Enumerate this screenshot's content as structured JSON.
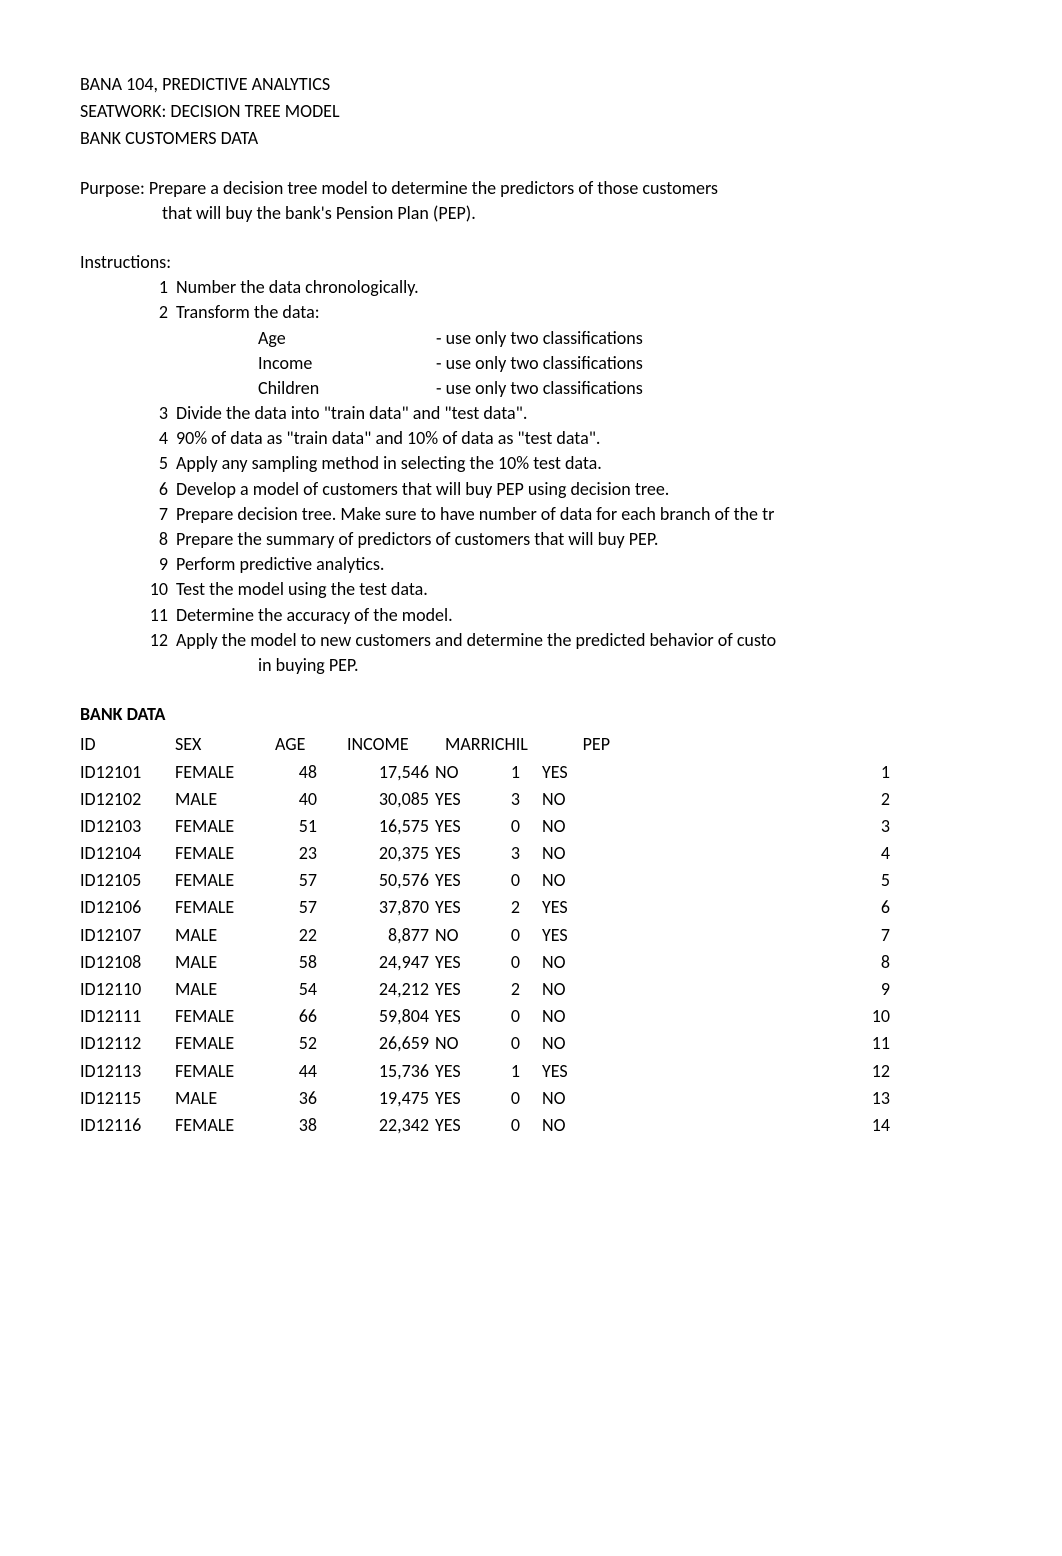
{
  "header": {
    "course": "BANA 104, PREDICTIVE ANALYTICS",
    "seatwork": "SEATWORK:  DECISION TREE MODEL",
    "dataset": "BANK CUSTOMERS DATA"
  },
  "purpose": {
    "label": "Purpose:  ",
    "line1": "Prepare a decision tree model to determine the predictors of those customers",
    "line2": "that will buy the bank's Pension Plan (PEP)."
  },
  "instructions": {
    "label": "Instructions:",
    "items": [
      {
        "num": "1",
        "text": "Number the data chronologically."
      },
      {
        "num": "2",
        "text": "Transform the data:"
      },
      {
        "num": "3",
        "text": "Divide the data into \"train data\" and \"test data\"."
      },
      {
        "num": "4",
        "text": "90% of data as \"train data\" and 10% of data as \"test data\"."
      },
      {
        "num": "5",
        "text": "Apply any sampling method in selecting the 10% test data."
      },
      {
        "num": "6",
        "text": "Develop a model of customers that will buy PEP using decision tree."
      },
      {
        "num": "7",
        "text": "Prepare decision tree. Make sure to have number of data for each branch of the tr"
      },
      {
        "num": "8",
        "text": "Prepare the summary of predictors of customers that will buy PEP."
      },
      {
        "num": "9",
        "text": "Perform predictive analytics."
      },
      {
        "num": "10",
        "text": "Test the model using the test data."
      },
      {
        "num": "11",
        "text": "Determine the accuracy of the model."
      },
      {
        "num": "12",
        "text": "Apply the model to new customers and determine the predicted behavior of custo"
      }
    ],
    "transform_sub": [
      {
        "label": "Age",
        "value": "- use only two classifications"
      },
      {
        "label": "Income",
        "value": "- use only two classifications"
      },
      {
        "label": "Children",
        "value": "- use only two classifications"
      }
    ],
    "item12_sub": "in buying PEP."
  },
  "bank_data": {
    "title": "BANK DATA",
    "headers": {
      "id": "ID",
      "sex": "SEX",
      "age": "AGE",
      "income": "INCOME",
      "married_child": "MARRICHIL",
      "pep": "PEP"
    },
    "rows": [
      {
        "id": "ID12101",
        "sex": "FEMALE",
        "age": "48",
        "income": "17,546",
        "married": "NO",
        "children": "1",
        "pep": "YES",
        "rownum": "1"
      },
      {
        "id": "ID12102",
        "sex": "MALE",
        "age": "40",
        "income": "30,085",
        "married": "YES",
        "children": "3",
        "pep": "NO",
        "rownum": "2"
      },
      {
        "id": "ID12103",
        "sex": "FEMALE",
        "age": "51",
        "income": "16,575",
        "married": "YES",
        "children": "0",
        "pep": "NO",
        "rownum": "3"
      },
      {
        "id": "ID12104",
        "sex": "FEMALE",
        "age": "23",
        "income": "20,375",
        "married": "YES",
        "children": "3",
        "pep": "NO",
        "rownum": "4"
      },
      {
        "id": "ID12105",
        "sex": "FEMALE",
        "age": "57",
        "income": "50,576",
        "married": "YES",
        "children": "0",
        "pep": "NO",
        "rownum": "5"
      },
      {
        "id": "ID12106",
        "sex": "FEMALE",
        "age": "57",
        "income": "37,870",
        "married": "YES",
        "children": "2",
        "pep": "YES",
        "rownum": "6"
      },
      {
        "id": "ID12107",
        "sex": "MALE",
        "age": "22",
        "income": "8,877",
        "married": "NO",
        "children": "0",
        "pep": "YES",
        "rownum": "7"
      },
      {
        "id": "ID12108",
        "sex": "MALE",
        "age": "58",
        "income": "24,947",
        "married": "YES",
        "children": "0",
        "pep": "NO",
        "rownum": "8"
      },
      {
        "id": "ID12110",
        "sex": "MALE",
        "age": "54",
        "income": "24,212",
        "married": "YES",
        "children": "2",
        "pep": "NO",
        "rownum": "9"
      },
      {
        "id": "ID12111",
        "sex": "FEMALE",
        "age": "66",
        "income": "59,804",
        "married": "YES",
        "children": "0",
        "pep": "NO",
        "rownum": "10"
      },
      {
        "id": "ID12112",
        "sex": "FEMALE",
        "age": "52",
        "income": "26,659",
        "married": "NO",
        "children": "0",
        "pep": "NO",
        "rownum": "11"
      },
      {
        "id": "ID12113",
        "sex": "FEMALE",
        "age": "44",
        "income": "15,736",
        "married": "YES",
        "children": "1",
        "pep": "YES",
        "rownum": "12"
      },
      {
        "id": "ID12115",
        "sex": "MALE",
        "age": "36",
        "income": "19,475",
        "married": "YES",
        "children": "0",
        "pep": "NO",
        "rownum": "13"
      },
      {
        "id": "ID12116",
        "sex": "FEMALE",
        "age": "38",
        "income": "22,342",
        "married": "YES",
        "children": "0",
        "pep": "NO",
        "rownum": "14"
      }
    ]
  }
}
